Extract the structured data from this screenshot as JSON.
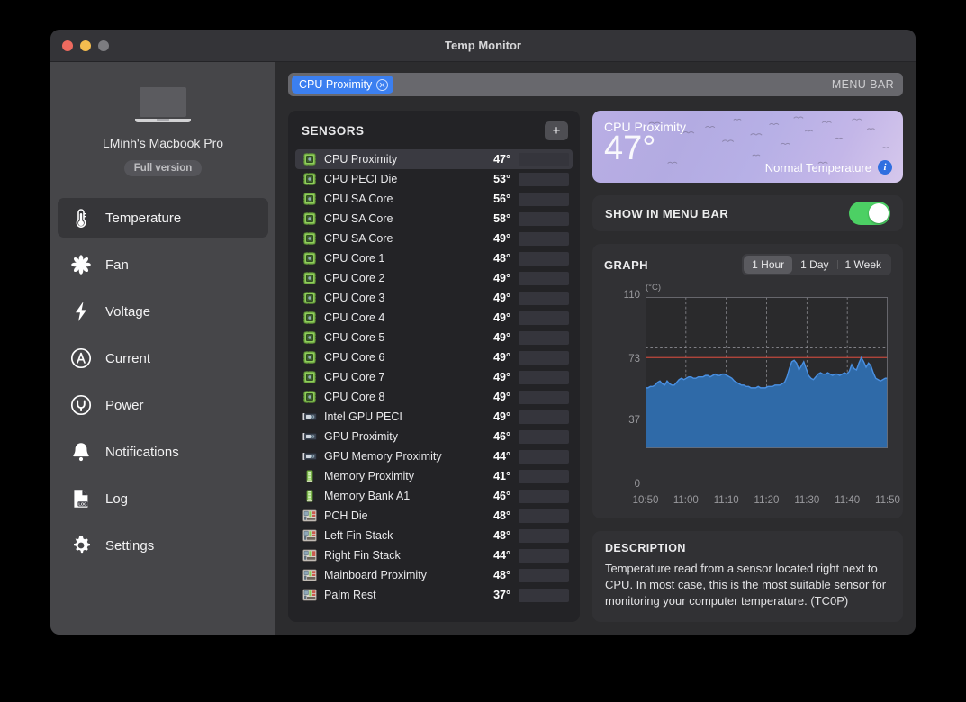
{
  "window": {
    "title": "Temp Monitor"
  },
  "sidebar": {
    "machine_name": "LMinh's Macbook Pro",
    "version_badge": "Full version",
    "items": [
      {
        "label": "Temperature",
        "icon": "thermometer-icon",
        "active": true
      },
      {
        "label": "Fan",
        "icon": "fan-icon",
        "active": false
      },
      {
        "label": "Voltage",
        "icon": "bolt-icon",
        "active": false
      },
      {
        "label": "Current",
        "icon": "ampere-circle-icon",
        "active": false
      },
      {
        "label": "Power",
        "icon": "plug-circle-icon",
        "active": false
      },
      {
        "label": "Notifications",
        "icon": "bell-icon",
        "active": false
      },
      {
        "label": "Log",
        "icon": "log-document-icon",
        "active": false
      },
      {
        "label": "Settings",
        "icon": "gear-icon",
        "active": false
      }
    ]
  },
  "menubar_strip": {
    "chip_label": "CPU Proximity",
    "right_label": "MENU BAR"
  },
  "sensors": {
    "title": "SENSORS",
    "add_label": "+",
    "rows": [
      {
        "name": "CPU Proximity",
        "value": "47°",
        "fill": 43,
        "icon": "cpu-chip-icon",
        "selected": true
      },
      {
        "name": "CPU PECI Die",
        "value": "53°",
        "fill": 48,
        "icon": "cpu-chip-icon",
        "selected": false
      },
      {
        "name": "CPU SA Core",
        "value": "56°",
        "fill": 51,
        "icon": "cpu-chip-icon",
        "selected": false
      },
      {
        "name": "CPU SA Core",
        "value": "58°",
        "fill": 53,
        "icon": "cpu-chip-icon",
        "selected": false
      },
      {
        "name": "CPU SA Core",
        "value": "49°",
        "fill": 45,
        "icon": "cpu-chip-icon",
        "selected": false
      },
      {
        "name": "CPU Core 1",
        "value": "48°",
        "fill": 44,
        "icon": "cpu-chip-icon",
        "selected": false
      },
      {
        "name": "CPU Core 2",
        "value": "49°",
        "fill": 45,
        "icon": "cpu-chip-icon",
        "selected": false
      },
      {
        "name": "CPU Core 3",
        "value": "49°",
        "fill": 45,
        "icon": "cpu-chip-icon",
        "selected": false
      },
      {
        "name": "CPU Core 4",
        "value": "49°",
        "fill": 45,
        "icon": "cpu-chip-icon",
        "selected": false
      },
      {
        "name": "CPU Core 5",
        "value": "49°",
        "fill": 45,
        "icon": "cpu-chip-icon",
        "selected": false
      },
      {
        "name": "CPU Core 6",
        "value": "49°",
        "fill": 45,
        "icon": "cpu-chip-icon",
        "selected": false
      },
      {
        "name": "CPU Core 7",
        "value": "49°",
        "fill": 45,
        "icon": "cpu-chip-icon",
        "selected": false
      },
      {
        "name": "CPU Core 8",
        "value": "49°",
        "fill": 45,
        "icon": "cpu-chip-icon",
        "selected": false
      },
      {
        "name": "Intel GPU PECI",
        "value": "49°",
        "fill": 45,
        "icon": "gpu-card-icon",
        "selected": false
      },
      {
        "name": "GPU Proximity",
        "value": "46°",
        "fill": 42,
        "icon": "gpu-card-icon",
        "selected": false
      },
      {
        "name": "GPU Memory Proximity",
        "value": "44°",
        "fill": 40,
        "icon": "gpu-card-icon",
        "selected": false
      },
      {
        "name": "Memory Proximity",
        "value": "41°",
        "fill": 37,
        "icon": "memory-stick-icon",
        "selected": false
      },
      {
        "name": "Memory Bank A1",
        "value": "46°",
        "fill": 42,
        "icon": "memory-stick-icon",
        "selected": false
      },
      {
        "name": "PCH Die",
        "value": "48°",
        "fill": 44,
        "icon": "mainboard-icon",
        "selected": false
      },
      {
        "name": "Left Fin Stack",
        "value": "48°",
        "fill": 44,
        "icon": "mainboard-icon",
        "selected": false
      },
      {
        "name": "Right Fin Stack",
        "value": "44°",
        "fill": 40,
        "icon": "mainboard-icon",
        "selected": false
      },
      {
        "name": "Mainboard Proximity",
        "value": "48°",
        "fill": 44,
        "icon": "mainboard-icon",
        "selected": false
      },
      {
        "name": "Palm Rest",
        "value": "37°",
        "fill": 34,
        "icon": "mainboard-icon",
        "selected": false
      }
    ]
  },
  "hero": {
    "sensor_name": "CPU Proximity",
    "temperature": "47°",
    "status": "Normal Temperature",
    "info_glyph": "i"
  },
  "show_in_menu_bar": {
    "label": "SHOW IN MENU BAR",
    "enabled": true
  },
  "graph": {
    "title": "GRAPH",
    "ranges": [
      {
        "label": "1 Hour",
        "active": true
      },
      {
        "label": "1 Day",
        "active": false
      },
      {
        "label": "1 Week",
        "active": false
      }
    ]
  },
  "description": {
    "title": "DESCRIPTION",
    "text": "Temperature read from a sensor located right next to CPU. In most case, this is the most suitable sensor for monitoring your computer temperature. (TC0P)"
  },
  "chart_data": {
    "type": "area",
    "title": "GRAPH",
    "xlabel": "",
    "ylabel": "(°C)",
    "unit": "(°C)",
    "ylim": [
      0,
      110
    ],
    "yticks": [
      0,
      37,
      73,
      110
    ],
    "xticks": [
      "10:50",
      "11:00",
      "11:10",
      "11:20",
      "11:30",
      "11:40",
      "11:50"
    ],
    "grid": true,
    "legend_position": "none",
    "threshold_line": {
      "value": 66,
      "color": "#c0483c"
    },
    "line_color": "#4a90e2",
    "fill_color": "#2f6aa8",
    "series": [
      {
        "name": "CPU Proximity",
        "values": [
          44,
          44,
          45,
          45,
          46,
          48,
          49,
          47,
          46,
          49,
          47,
          46,
          46,
          48,
          50,
          51,
          50,
          51,
          52,
          52,
          51,
          51,
          52,
          52,
          52,
          53,
          53,
          52,
          53,
          54,
          53,
          53,
          54,
          54,
          53,
          52,
          51,
          49,
          48,
          47,
          46,
          46,
          45,
          45,
          44,
          44,
          44,
          45,
          44,
          44,
          44,
          45,
          45,
          45,
          46,
          46,
          46,
          47,
          48,
          52,
          58,
          63,
          64,
          62,
          57,
          60,
          63,
          58,
          53,
          51,
          50,
          52,
          54,
          55,
          54,
          54,
          55,
          54,
          53,
          54,
          54,
          53,
          54,
          55,
          54,
          56,
          61,
          58,
          57,
          62,
          66,
          63,
          59,
          62,
          60,
          55,
          51,
          50,
          49,
          50,
          51,
          51
        ]
      }
    ]
  }
}
